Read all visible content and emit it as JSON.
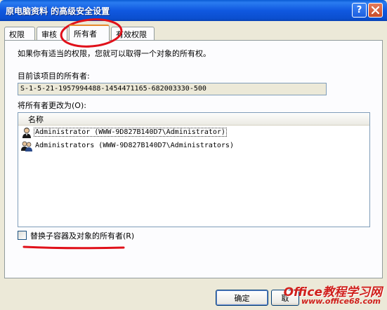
{
  "window": {
    "title": "原电脑资料 的高级安全设置"
  },
  "titlebar": {
    "help_glyph": "?",
    "help_icon": "help-icon",
    "close_icon": "close-icon"
  },
  "tabs": [
    {
      "label": "权限",
      "active": false
    },
    {
      "label": "审核",
      "active": false
    },
    {
      "label": "所有者",
      "active": true
    },
    {
      "label": "有效权限",
      "active": false
    }
  ],
  "owner_panel": {
    "intro": "如果你有适当的权限，您就可以取得一个对象的所有权。",
    "current_owner_label": "目前该项目的所有者:",
    "current_owner_value": "S-1-5-21-1957994488-1454471165-682003330-500",
    "change_owner_label": "将所有者更改为(O):",
    "list_column_name": "名称",
    "owners": [
      {
        "name": "Administrator (WWW-9D827B140D7\\Administrator)",
        "icon": "user-icon",
        "selected": true
      },
      {
        "name": "Administrators (WWW-9D827B140D7\\Administrators)",
        "icon": "group-icon",
        "selected": false
      }
    ],
    "replace_checkbox_label": "替换子容器及对象的所有者(R)",
    "replace_checked": false
  },
  "buttons": {
    "ok": "确定",
    "cancel": "取"
  },
  "watermark": {
    "main": "Office教程学习网",
    "url": "www.office68.com"
  },
  "colors": {
    "title_blue": "#0b4fcf",
    "annotation_red": "#e0101a",
    "watermark_red": "#d0201c",
    "active_tab_orange": "#e68b2c"
  }
}
